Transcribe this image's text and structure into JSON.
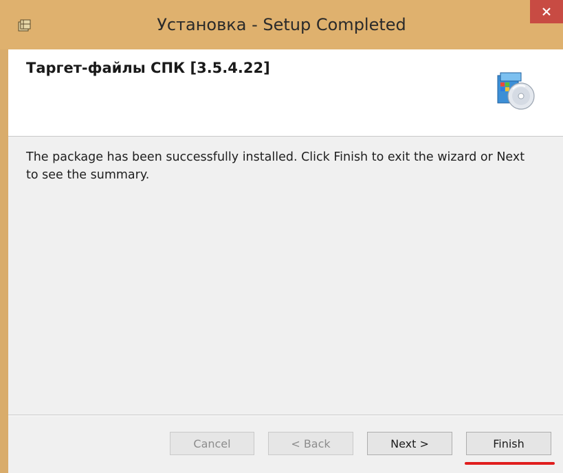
{
  "window": {
    "title": "Установка - Setup Completed",
    "close_glyph": "✕"
  },
  "header": {
    "product_title": "Таргет-файлы СПК [3.5.4.22]",
    "icon": "setup-cd-icon"
  },
  "body": {
    "message": "The package has been successfully installed. Click Finish to exit the wizard or Next to see the summary."
  },
  "buttons": {
    "cancel": {
      "label": "Cancel",
      "enabled": false
    },
    "back": {
      "label": "< Back",
      "enabled": false
    },
    "next": {
      "label": "Next >",
      "enabled": true
    },
    "finish": {
      "label": "Finish",
      "enabled": true,
      "highlighted": true
    }
  },
  "colors": {
    "titlebar": "#dfb16e",
    "close_button": "#c84b43",
    "highlight": "#e01e1e"
  }
}
